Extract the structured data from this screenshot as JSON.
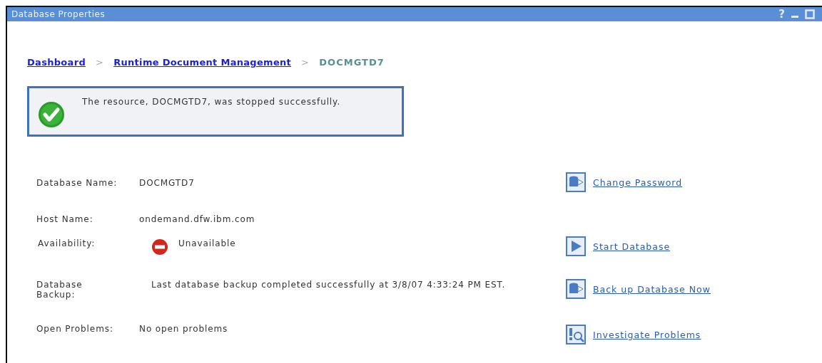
{
  "window": {
    "title": "Database Properties",
    "controls": [
      {
        "kind": "help",
        "label": "?"
      },
      {
        "kind": "minimize"
      },
      {
        "kind": "maximize"
      }
    ]
  },
  "breadcrumb_separator": ">",
  "breadcrumb": [
    {
      "label": "Dashboard",
      "link": true
    },
    {
      "label": "Runtime Document Management",
      "link": true
    },
    {
      "label": "DOCMGTD7",
      "link": false
    }
  ],
  "message": {
    "kind": "success",
    "text": "The resource, DOCMGTD7, was stopped successfully."
  },
  "rows": [
    {
      "kind": "text",
      "label": "Database Name:",
      "value": "DOCMGTD7",
      "action": {
        "kind": "database",
        "label": "Change Password"
      }
    },
    {
      "kind": "text",
      "label": "Host Name:",
      "value": "ondemand.dfw.ibm.com"
    },
    {
      "kind": "unavailable",
      "label": "Availability:",
      "value": "Unavailable",
      "action": {
        "kind": "start",
        "label": "Start Database"
      }
    },
    {
      "kind": "text",
      "label": "Database Backup:",
      "value": "Last database backup completed successfully at 3/8/07 4:33:24 PM EST.",
      "action": {
        "kind": "database",
        "label": "Back up Database Now"
      }
    },
    {
      "kind": "text",
      "label": "Open Problems:",
      "value": "No open problems",
      "action": {
        "kind": "investigate",
        "label": "Investigate Problems"
      }
    }
  ]
}
